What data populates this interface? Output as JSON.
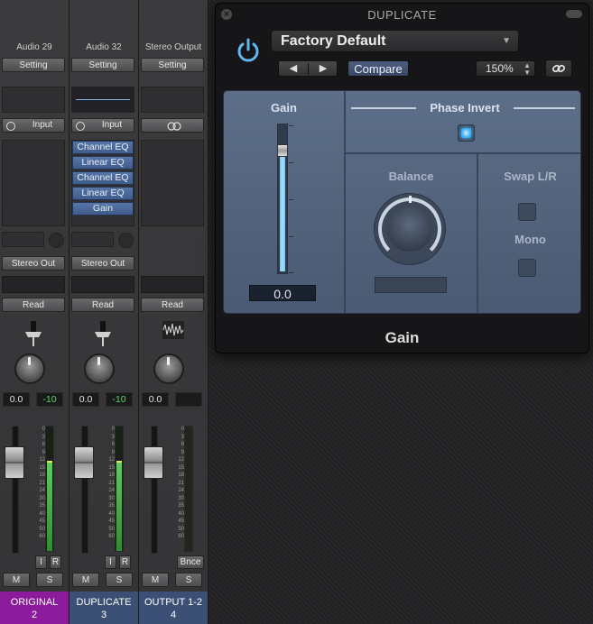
{
  "channels": [
    {
      "name": "Audio 29",
      "setting": "Setting",
      "input_label": "Input",
      "plugins": [],
      "output": "Stereo Out",
      "automation": "Read",
      "pan_value": "0.0",
      "peak_value": "-10",
      "meter_level": 0.72,
      "footer_name": "ORIGINAL",
      "footer_num": "2",
      "footer_color": "#8b1b9b",
      "mute": "M",
      "solo": "S",
      "input_mon": "I",
      "record": "R"
    },
    {
      "name": "Audio 32",
      "setting": "Setting",
      "input_label": "Input",
      "plugins": [
        "Channel EQ",
        "Linear EQ",
        "Channel EQ",
        "Linear EQ",
        "Gain"
      ],
      "output": "Stereo Out",
      "automation": "Read",
      "pan_value": "0.0",
      "peak_value": "-10",
      "meter_level": 0.72,
      "footer_name": "DUPLICATE",
      "footer_num": "3",
      "footer_color": "#3c4f74",
      "mute": "M",
      "solo": "S",
      "input_mon": "I",
      "record": "R"
    },
    {
      "name": "Stereo Output",
      "setting": "Setting",
      "input_label": "",
      "plugins": [],
      "output": "",
      "automation": "Read",
      "pan_value": "0.0",
      "peak_value": "",
      "meter_level": 0,
      "footer_name": "OUTPUT 1-2",
      "footer_num": "4",
      "footer_color": "#3c4f74",
      "mute": "M",
      "solo": "S",
      "bounce": "Bnce"
    }
  ],
  "meter_scale": [
    "0",
    "3",
    "6",
    "9",
    "12",
    "15",
    "18",
    "21",
    "24",
    "30",
    "35",
    "40",
    "45",
    "50",
    "60"
  ],
  "plugin_window": {
    "title": "DUPLICATE",
    "preset": "Factory Default",
    "prev_symbol": "◀",
    "next_symbol": "▶",
    "compare_label": "Compare",
    "zoom": "150%",
    "gain_label": "Gain",
    "gain_value": "0.0",
    "gain_level": 0.82,
    "phase_invert_label": "Phase Invert",
    "balance_label": "Balance",
    "swap_label": "Swap L/R",
    "mono_label": "Mono",
    "plugin_name": "Gain",
    "accent_color": "#34a9ee"
  }
}
